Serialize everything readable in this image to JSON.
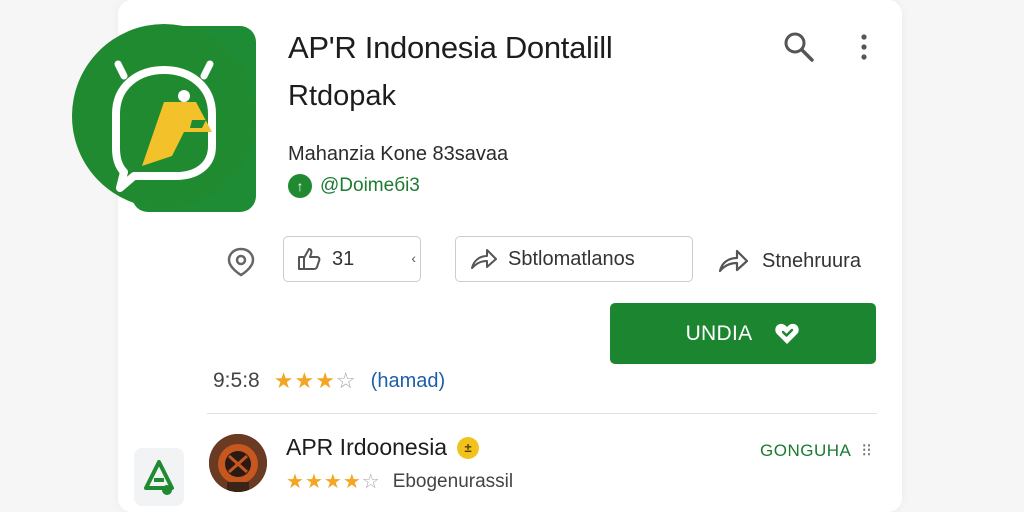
{
  "app": {
    "title": "AP'R Indonesia Dontalill",
    "subtitle": "Rtdopak",
    "developer": "Mahanzia Kone 83savaa",
    "tag_label": "@Doimeбi3",
    "tag_icon": "leaf-icon",
    "brand_color": "#1f8a2f"
  },
  "toolbar": {
    "search_icon": "search-icon",
    "more_icon": "more-vert-icon"
  },
  "actions": {
    "pin_icon": "location-pin-icon",
    "like_count": "31",
    "share_label": "Sbtlomatlanos",
    "share2_label": "Stnehruura"
  },
  "install": {
    "label": "UNDIA",
    "icon": "heart-icon",
    "color": "#1c8530"
  },
  "rating": {
    "value": "9:5:8",
    "stars_filled": 3,
    "stars_total": 4,
    "reviews_label": "(hamad)",
    "star_color": "#f3a623"
  },
  "list_item": {
    "title": "APR Irdoonesia",
    "badge": "±",
    "stars_filled": 4,
    "stars_total": 5,
    "meta": "Ebogenurassil",
    "action_label": "GONGUHA",
    "action_dots": "⁝⁝",
    "action_color": "#1d7a31"
  }
}
